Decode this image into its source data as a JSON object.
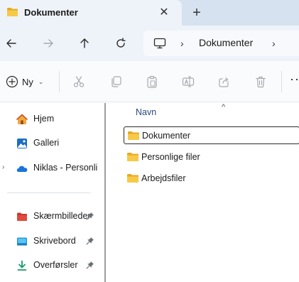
{
  "tab": {
    "title": "Dokumenter",
    "close_glyph": "✕",
    "new_tab_glyph": "+"
  },
  "navigation": {
    "back_icon": "arrow-left-icon",
    "forward_icon": "arrow-right-icon",
    "up_icon": "arrow-up-icon",
    "refresh_icon": "refresh-icon"
  },
  "address": {
    "separator": "›",
    "crumb": "Dokumenter"
  },
  "command_bar": {
    "new_label": "Ny",
    "new_caret": "⌄",
    "more_glyph": "··"
  },
  "sidebar": {
    "items": [
      {
        "label": "Hjem",
        "icon": "home-icon"
      },
      {
        "label": "Galleri",
        "icon": "gallery-icon"
      },
      {
        "label": "Niklas - Personlig",
        "icon": "onedrive-cloud-icon",
        "expander": "›"
      },
      {
        "label": "Skærmbilleder",
        "icon": "screenshots-folder-icon",
        "pinned": true
      },
      {
        "label": "Skrivebord",
        "icon": "desktop-icon",
        "pinned": true
      },
      {
        "label": "Overførsler",
        "icon": "downloads-icon",
        "pinned": true
      }
    ]
  },
  "content": {
    "sort_glyph": "^",
    "column_name": "Navn",
    "rows": [
      {
        "label": "Dokumenter",
        "selected": true
      },
      {
        "label": "Personlige filer",
        "selected": false
      },
      {
        "label": "Arbejdsfiler",
        "selected": false
      }
    ]
  },
  "colors": {
    "tabbar_bg": "#d6e2ef",
    "tab_active_bg": "#eef3f9",
    "folder_yellow": "#f4bf3b",
    "accent_blue": "#0f6cbd"
  }
}
